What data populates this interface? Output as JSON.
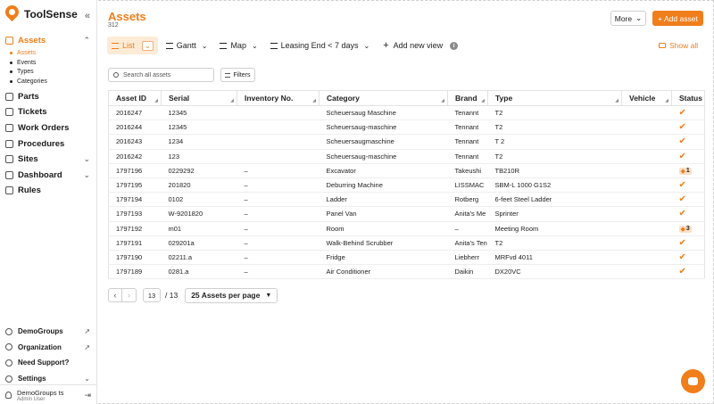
{
  "brand": {
    "name": "ToolSense"
  },
  "sidebar": {
    "items": [
      {
        "label": "Assets",
        "active": true,
        "expanded": true
      },
      {
        "label": "Parts"
      },
      {
        "label": "Tickets"
      },
      {
        "label": "Work Orders"
      },
      {
        "label": "Procedures"
      },
      {
        "label": "Sites",
        "chevron": true
      },
      {
        "label": "Dashboard",
        "chevron": true
      },
      {
        "label": "Rules"
      }
    ],
    "asset_subitems": [
      "Assets",
      "Events",
      "Types",
      "Categories"
    ],
    "bottom": [
      {
        "label": "DemoGroups"
      },
      {
        "label": "Organization"
      },
      {
        "label": "Need Support?"
      },
      {
        "label": "Settings"
      }
    ],
    "user": {
      "name": "DemoGroups ts",
      "role": "Admin User"
    }
  },
  "header": {
    "title": "Assets",
    "count": "312",
    "more_label": "More",
    "add_label": "+ Add asset"
  },
  "views": {
    "tabs": [
      "List",
      "Gantt",
      "Map",
      "Leasing End < 7 days"
    ],
    "add_view": "Add new view",
    "show_all": "Show all"
  },
  "search": {
    "placeholder": "Search all assets"
  },
  "filters_label": "Filters",
  "table": {
    "columns": [
      "Asset ID",
      "Serial",
      "Inventory No.",
      "Category",
      "Brand",
      "Type",
      "Vehicle",
      "Status"
    ],
    "rows": [
      [
        "2016247",
        "12345",
        "",
        "Scheuersaug Maschine",
        "Tenannt",
        "T2",
        "",
        "check"
      ],
      [
        "2016244",
        "12345",
        "",
        "Scheuersaug-maschine",
        "Tennant",
        "T2",
        "",
        "check"
      ],
      [
        "2016243",
        "1234",
        "",
        "Scheuersaugmaschine",
        "Tennant",
        "T 2",
        "",
        "check"
      ],
      [
        "2016242",
        "123",
        "",
        "Scheuersaug-maschine",
        "Tennant",
        "T2",
        "",
        "check"
      ],
      [
        "1797196",
        "0229292",
        "–",
        "Excavator",
        "Takeushi",
        "TB210R",
        "",
        "tag:1"
      ],
      [
        "1797195",
        "201820",
        "–",
        "Deburring Machine",
        "LISSMAC",
        "SBM-L 1000 G1S2",
        "",
        "check"
      ],
      [
        "1797194",
        "0102",
        "–",
        "Ladder",
        "Rotberg",
        "6-feet Steel Ladder",
        "",
        "check"
      ],
      [
        "1797193",
        "W-9201820",
        "–",
        "Panel Van",
        "Anita's Me",
        "Sprinter",
        "",
        "check"
      ],
      [
        "1797192",
        "m01",
        "–",
        "Room",
        "–",
        "Meeting Room",
        "",
        "tag:3"
      ],
      [
        "1797191",
        "029201a",
        "–",
        "Walk-Behind Scrubber",
        "Anita's Ten",
        "T2",
        "",
        "check"
      ],
      [
        "1797190",
        "02211.a",
        "–",
        "Fridge",
        "Liebherr",
        "MRFvd 4011",
        "",
        "check"
      ],
      [
        "1797189",
        "0281.a",
        "–",
        "Air Conditioner",
        "Daikin",
        "DX20VC",
        "",
        "check"
      ]
    ]
  },
  "pagination": {
    "page": "13",
    "total": "/ 13",
    "per_page": "25 Assets per page"
  },
  "colors": {
    "accent": "#f07e1b",
    "accent_light": "#fdebd6"
  }
}
